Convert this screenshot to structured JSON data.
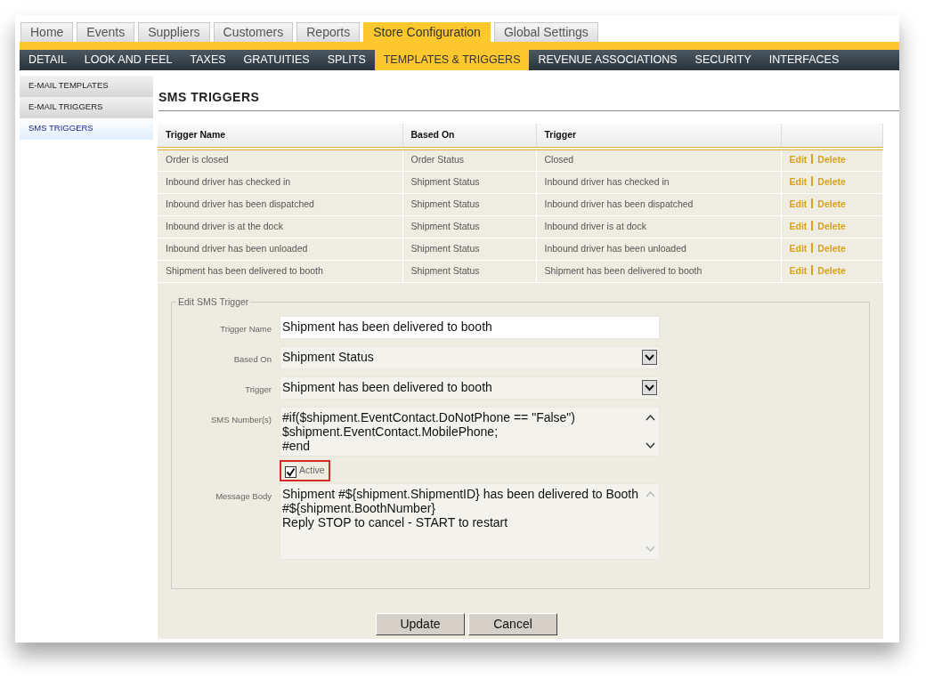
{
  "top_tabs": [
    {
      "label": "Home",
      "selected": false
    },
    {
      "label": "Events",
      "selected": false
    },
    {
      "label": "Suppliers",
      "selected": false
    },
    {
      "label": "Customers",
      "selected": false
    },
    {
      "label": "Reports",
      "selected": false
    },
    {
      "label": "Store Configuration",
      "selected": true
    },
    {
      "label": "Global Settings",
      "selected": false
    }
  ],
  "sub_nav": [
    {
      "label": "DETAIL",
      "selected": false
    },
    {
      "label": "LOOK AND FEEL",
      "selected": false
    },
    {
      "label": "TAXES",
      "selected": false
    },
    {
      "label": "GRATUITIES",
      "selected": false
    },
    {
      "label": "SPLITS",
      "selected": false
    },
    {
      "label": "TEMPLATES & TRIGGERS",
      "selected": true
    },
    {
      "label": "REVENUE ASSOCIATIONS",
      "selected": false
    },
    {
      "label": "SECURITY",
      "selected": false
    },
    {
      "label": "INTERFACES",
      "selected": false
    }
  ],
  "sidebar": {
    "items": [
      {
        "label": "E-MAIL TEMPLATES",
        "selected": false
      },
      {
        "label": "E-MAIL TRIGGERS",
        "selected": false
      },
      {
        "label": "SMS TRIGGERS",
        "selected": true
      }
    ]
  },
  "page_title": "SMS TRIGGERS",
  "table": {
    "columns": [
      "Trigger Name",
      "Based On",
      "Trigger"
    ],
    "rows": [
      {
        "cells": [
          "Order is closed",
          "Order Status",
          "Closed"
        ],
        "actions": [
          "Edit",
          "Delete"
        ]
      },
      {
        "cells": [
          "Inbound driver has checked in",
          "Shipment Status",
          "Inbound driver has checked in"
        ],
        "actions": [
          "Edit",
          "Delete"
        ]
      },
      {
        "cells": [
          "Inbound driver has been dispatched",
          "Shipment Status",
          "Inbound driver has been dispatched"
        ],
        "actions": [
          "Edit",
          "Delete"
        ]
      },
      {
        "cells": [
          "Inbound driver is at the dock",
          "Shipment Status",
          "Inbound driver is at dock"
        ],
        "actions": [
          "Edit",
          "Delete"
        ]
      },
      {
        "cells": [
          "Inbound driver has been unloaded",
          "Shipment Status",
          "Inbound driver has been unloaded"
        ],
        "actions": [
          "Edit",
          "Delete"
        ]
      },
      {
        "cells": [
          "Shipment has been delivered to booth",
          "Shipment Status",
          "Shipment has been delivered to booth"
        ],
        "actions": [
          "Edit",
          "Delete"
        ]
      }
    ]
  },
  "form": {
    "legend": "Edit SMS Trigger",
    "fields": [
      {
        "kind": "text",
        "label": "Trigger Name",
        "value": "Shipment has been delivered to booth"
      },
      {
        "kind": "select",
        "label": "Based On",
        "value": "Shipment Status"
      },
      {
        "kind": "select",
        "label": "Trigger",
        "value": "Shipment has been delivered to booth"
      },
      {
        "kind": "textarea",
        "label": "SMS Number(s)",
        "value": "#if($shipment.EventContact.DoNotPhone == \"False\")\n$shipment.EventContact.MobilePhone;\n#end"
      },
      {
        "kind": "checkbox",
        "label": "Active",
        "checked": true,
        "highlighted": true
      },
      {
        "kind": "textarea",
        "label": "Message Body",
        "value": "Shipment #${shipment.ShipmentID} has been delivered to Booth\n#${shipment.BoothNumber}\nReply STOP to cancel - START to restart"
      }
    ],
    "buttons": [
      "Update",
      "Cancel"
    ]
  }
}
